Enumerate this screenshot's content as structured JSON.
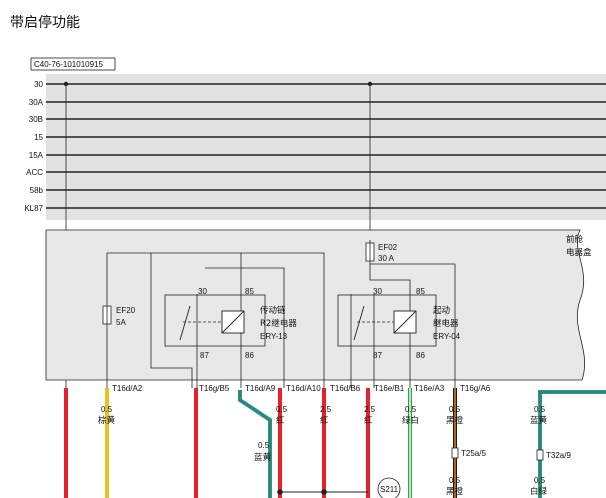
{
  "title": "带启停功能",
  "doc_code": "C40-76-101010915",
  "bus_lines": [
    "30",
    "30A",
    "30B",
    "15",
    "15A",
    "ACC",
    "58b",
    "KL87"
  ],
  "box_label": [
    "前舱",
    "电器盒"
  ],
  "fuses": [
    {
      "name": "EF02",
      "rating": "30 A"
    },
    {
      "name": "EF20",
      "rating": "5A"
    }
  ],
  "relays": [
    {
      "name": "传动链",
      "type": "R2继电器",
      "id": "ERY-13",
      "pins": {
        "p30": "30",
        "p85": "85",
        "p87": "87",
        "p86": "86"
      }
    },
    {
      "name": "起动",
      "type": "继电器",
      "id": "ERY-04",
      "pins": {
        "p30": "30",
        "p85": "85",
        "p87": "87",
        "p86": "86"
      }
    }
  ],
  "connectors": [
    "T16d/A2",
    "T16g/B5",
    "T16d/A9",
    "T16d/A10",
    "T16d/B6",
    "T16e/B1",
    "T16e/A3",
    "T16g/A6"
  ],
  "wires": [
    {
      "gauge": "0.5",
      "color": "棕黄"
    },
    {
      "gauge": "0.5",
      "color": "蓝黄"
    },
    {
      "gauge": "0.5",
      "color": "红"
    },
    {
      "gauge": "2.5",
      "color": "红"
    },
    {
      "gauge": "2.5",
      "color": "红"
    },
    {
      "gauge": "0.5",
      "color": "绿白"
    },
    {
      "gauge": "0.5",
      "color": "黑橙"
    },
    {
      "gauge": "0.5",
      "color": "蓝黄"
    }
  ],
  "lower_wires": [
    {
      "gauge": "0.5",
      "color": "黑橙"
    },
    {
      "gauge": "0.5",
      "color": "白绿"
    }
  ],
  "lower_connectors": [
    "T25a/5",
    "T32a/9"
  ],
  "splice": "S211",
  "colors": {
    "red": "#e8202a",
    "yellow": "#e8c21a",
    "green": "#2aa34a",
    "blue": "#2f6fd0",
    "black": "#1a1a1a",
    "orange": "#f08a24",
    "box_fill": "#e8e8e8"
  }
}
